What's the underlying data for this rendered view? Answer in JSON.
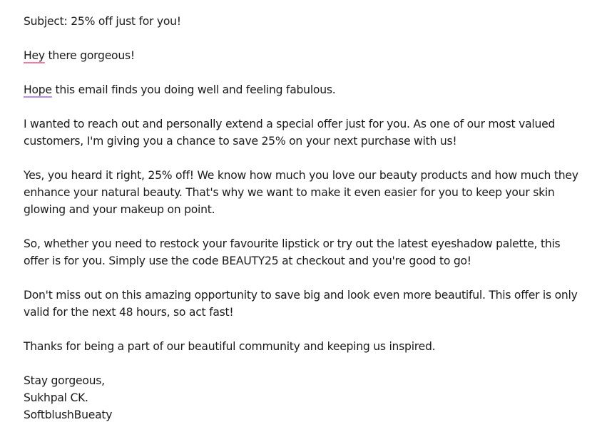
{
  "email": {
    "subject_line": "Subject: 25% off just for you!",
    "greeting_word": "Hey",
    "greeting_rest": " there gorgeous!",
    "hope_word": "Hope",
    "hope_rest": " this email finds you doing well and feeling fabulous.",
    "paragraphs": [
      "I wanted to reach out and personally extend a special offer just for you. As one of our most valued customers, I'm giving you a chance to save 25% on your next purchase with us!",
      "Yes, you heard it right, 25% off! We know how much you love our beauty products and how much they enhance your natural beauty. That's why we want to make it even easier for you to keep your skin glowing and your makeup on point.",
      "So, whether you need to restock your favourite lipstick or try out the latest eyeshadow palette, this offer is for you. Simply use the code BEAUTY25 at checkout and you're good to go!",
      "Don't miss out on this amazing opportunity to save big and look even more beautiful. This offer is only valid for the next 48 hours, so act fast!",
      "Thanks for being a part of our beautiful community and keeping us inspired."
    ],
    "signoff": "Stay gorgeous,",
    "sender_name": "Sukhpal CK.",
    "brand_name": "SoftblushBueaty"
  },
  "colors": {
    "text": "#1a1a1a",
    "spellcheck_pink": "#f07aa3",
    "spellcheck_purple": "#b78be6"
  }
}
